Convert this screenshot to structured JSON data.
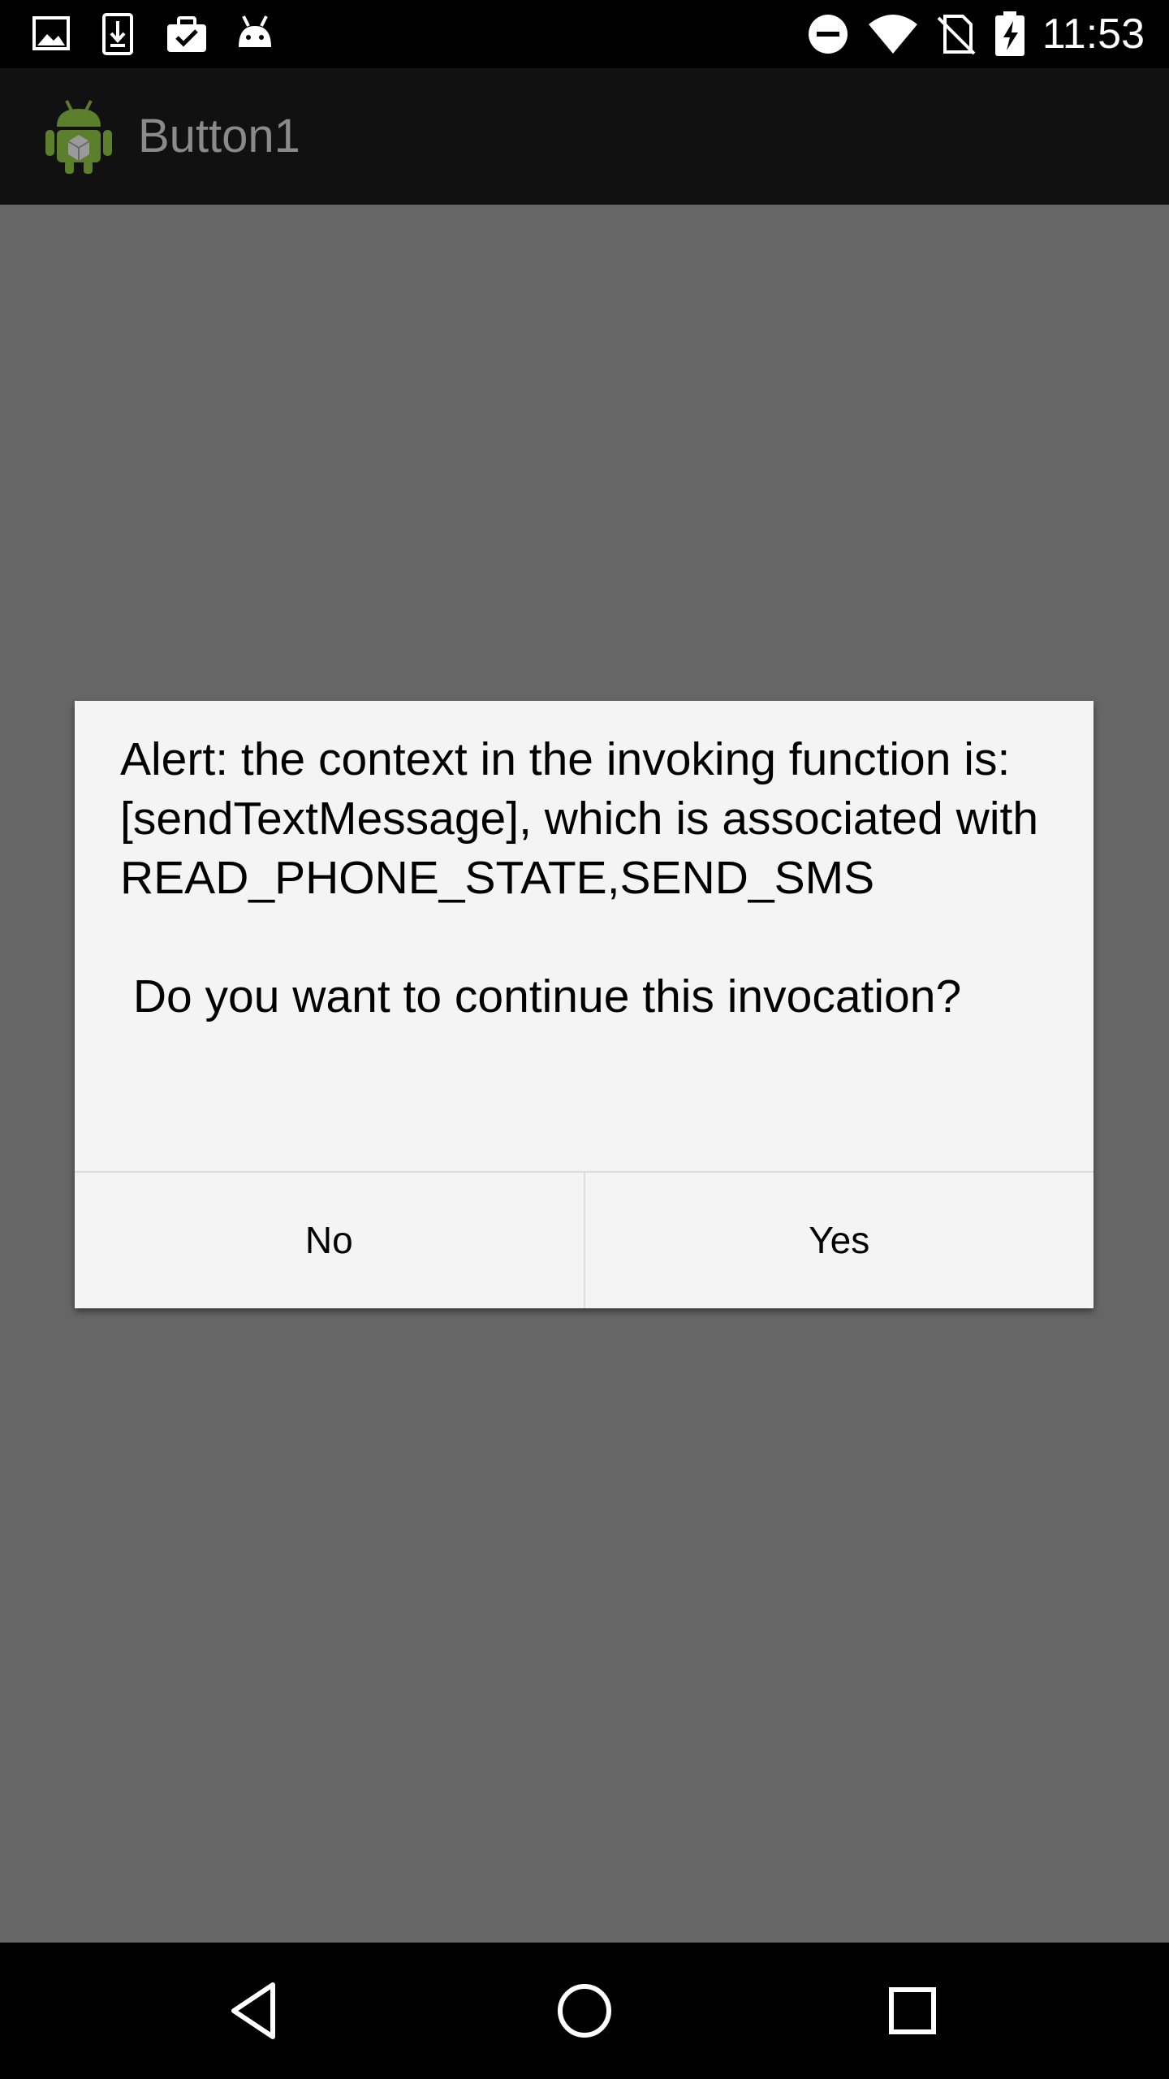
{
  "status_bar": {
    "time": "11:53",
    "left_icons": [
      "image-icon",
      "download-icon",
      "briefcase-check-icon",
      "android-debug-icon"
    ],
    "right_icons": [
      "do-not-disturb-icon",
      "wifi-icon",
      "no-sim-icon",
      "battery-charging-icon"
    ]
  },
  "action_bar": {
    "title": "Button1",
    "icon": "android-robot-icon"
  },
  "dialog": {
    "message": "Alert: the context in the invoking function is:[sendTextMessage], which is associated with READ_PHONE_STATE,SEND_SMS\n\n Do you want to continue this invocation?",
    "negative_label": "No",
    "positive_label": "Yes"
  },
  "nav_bar": {
    "icons": [
      "back-icon",
      "home-icon",
      "recents-icon"
    ]
  },
  "colors": {
    "scrim": "#666666",
    "action_bar_bg": "#111111",
    "dialog_bg": "#f4f4f4",
    "title_text": "#8a8a8a"
  }
}
